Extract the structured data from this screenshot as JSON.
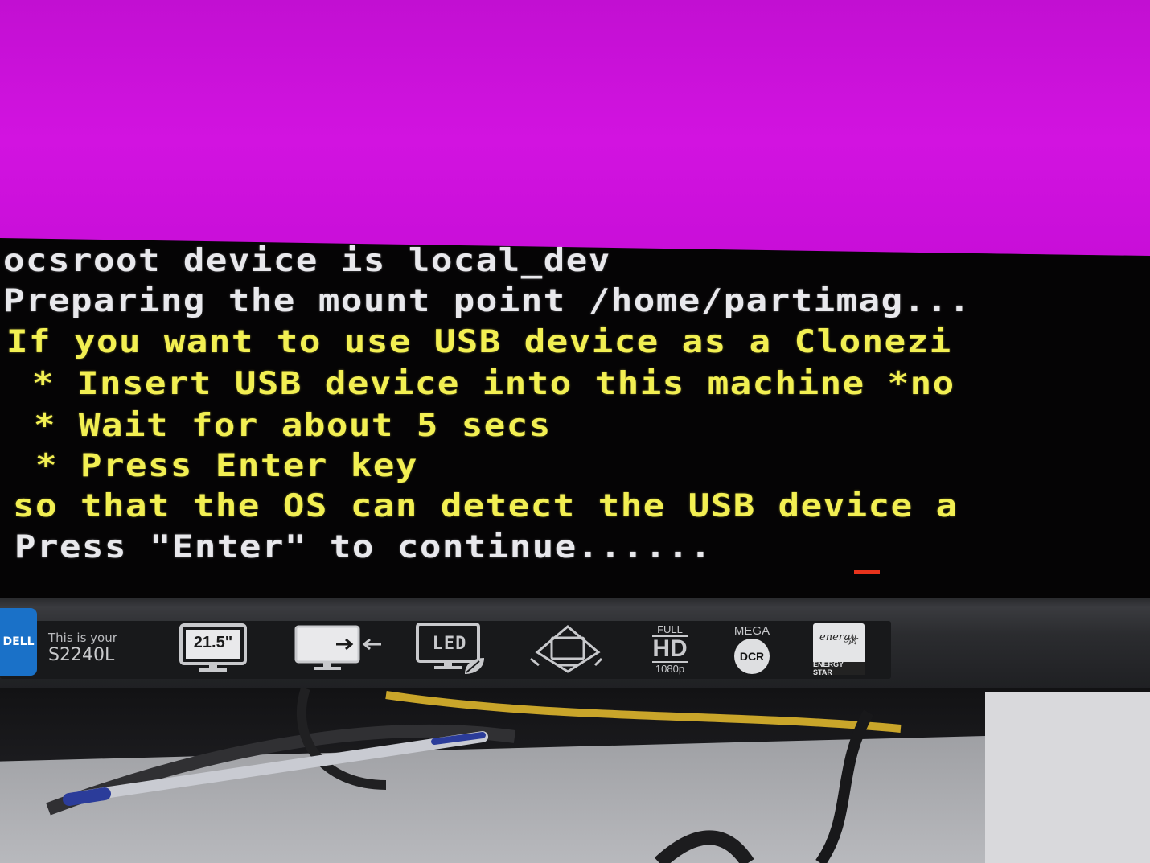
{
  "console": {
    "lines": [
      {
        "text": "ocsroot device is local_dev",
        "color": "#e8e8ec"
      },
      {
        "text": "Preparing the mount point /home/partimag...",
        "color": "#e8e8ec"
      },
      {
        "text": "If you want to use USB device as a Clonezi",
        "color": "#f2ef52"
      },
      {
        "text": " * Insert USB device into this machine *no",
        "color": "#f2ef52"
      },
      {
        "text": " * Wait for about 5 secs",
        "color": "#f2ef52"
      },
      {
        "text": " * Press Enter key",
        "color": "#f2ef52"
      },
      {
        "text": "so that the OS can detect the USB device a",
        "color": "#f2ef52"
      },
      {
        "text": "Press \"Enter\" to continue......",
        "color": "#e8e8ec"
      }
    ],
    "background": "#050405",
    "screen_background": "#c20fd2"
  },
  "monitor": {
    "brand": "DELL",
    "tagline": "This is your",
    "model": "S2240L",
    "badges": {
      "size": "21.5\"",
      "led": "LED",
      "hd_top": "FULL",
      "hd_main": "HD",
      "hd_bottom": "1080p",
      "dcr_top": "MEGA",
      "dcr_main": "DCR",
      "energy": "ENERGY STAR",
      "energy_script": "energy"
    }
  }
}
